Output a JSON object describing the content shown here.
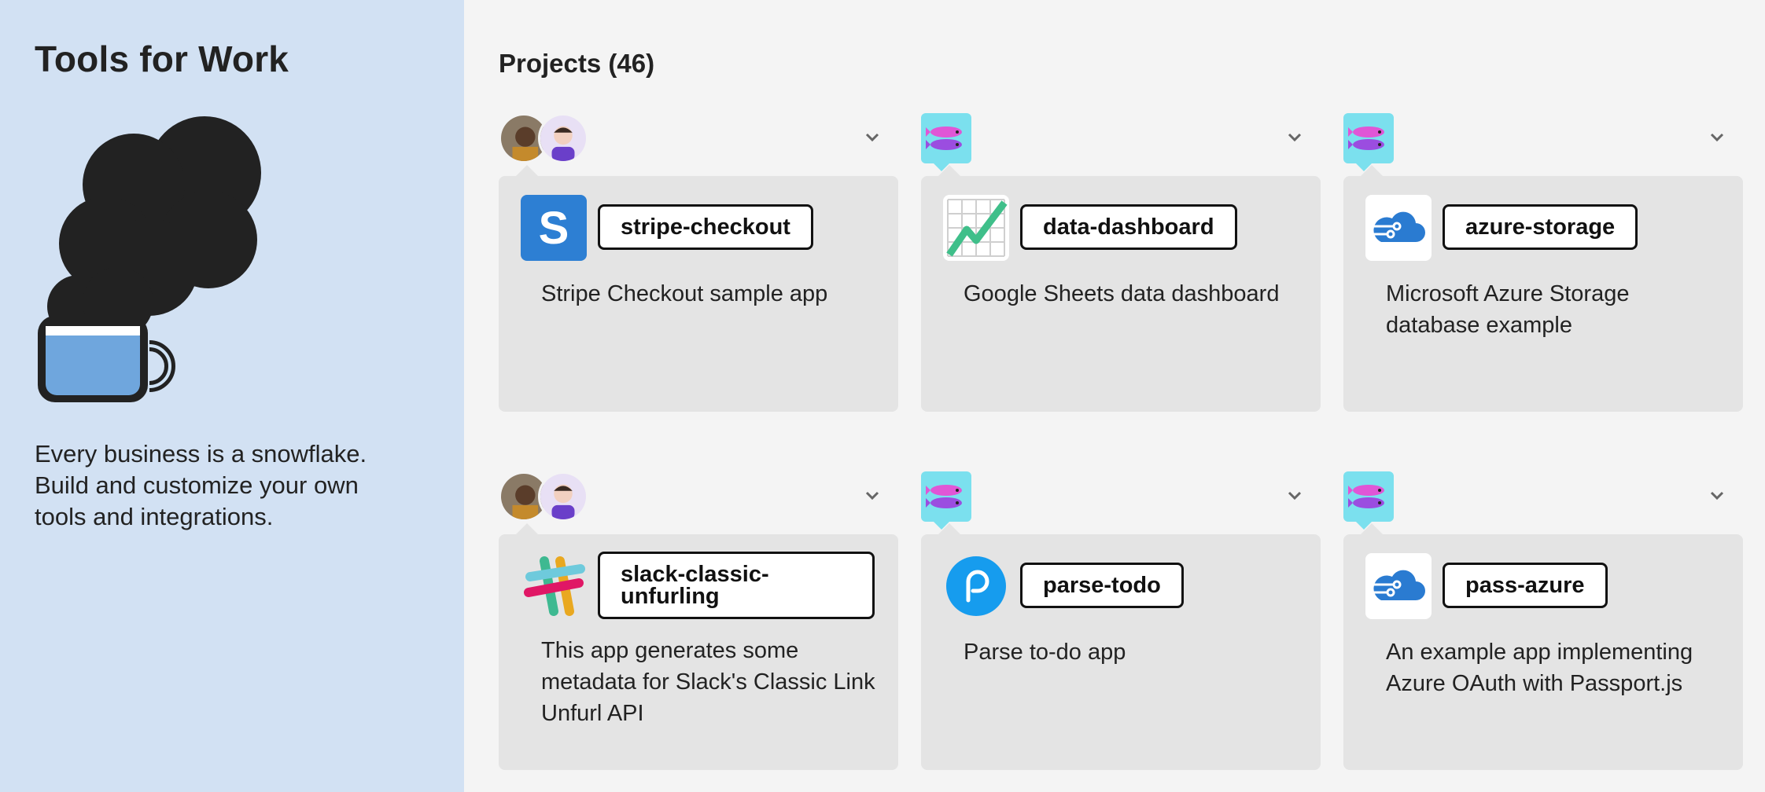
{
  "sidebar": {
    "title": "Tools for Work",
    "tagline": "Every business is a snowflake. Build and customize your own tools and integrations."
  },
  "main": {
    "heading": "Projects (46)",
    "projects": [
      {
        "name": "stripe-checkout",
        "description": "Stripe Checkout sample app",
        "owner": "users",
        "logo": "stripe-logo-icon"
      },
      {
        "name": "data-dashboard",
        "description": "Google Sheets data dashboard",
        "owner": "team",
        "logo": "chart-logo-icon"
      },
      {
        "name": "azure-storage",
        "description": "Microsoft Azure Storage database example",
        "owner": "team",
        "logo": "azure-cloud-icon"
      },
      {
        "name": "slack-classic-unfurling",
        "description": "This app generates some metadata for Slack's Classic Link Unfurl API",
        "owner": "users",
        "logo": "slack-logo-icon"
      },
      {
        "name": "parse-todo",
        "description": "Parse to-do app",
        "owner": "team",
        "logo": "parse-logo-icon"
      },
      {
        "name": "pass-azure",
        "description": "An example app implementing Azure OAuth with Passport.js",
        "owner": "team",
        "logo": "azure-cloud-icon"
      }
    ]
  },
  "colors": {
    "sidebar_bg": "#d2e1f3",
    "main_bg": "#f4f4f4",
    "card_bg": "#e4e4e4",
    "team_avatar_bg": "#7be0ee"
  },
  "icons": [
    "coffee-cup-icon",
    "chevron-down-icon",
    "user-avatar",
    "team-fish-icon"
  ]
}
